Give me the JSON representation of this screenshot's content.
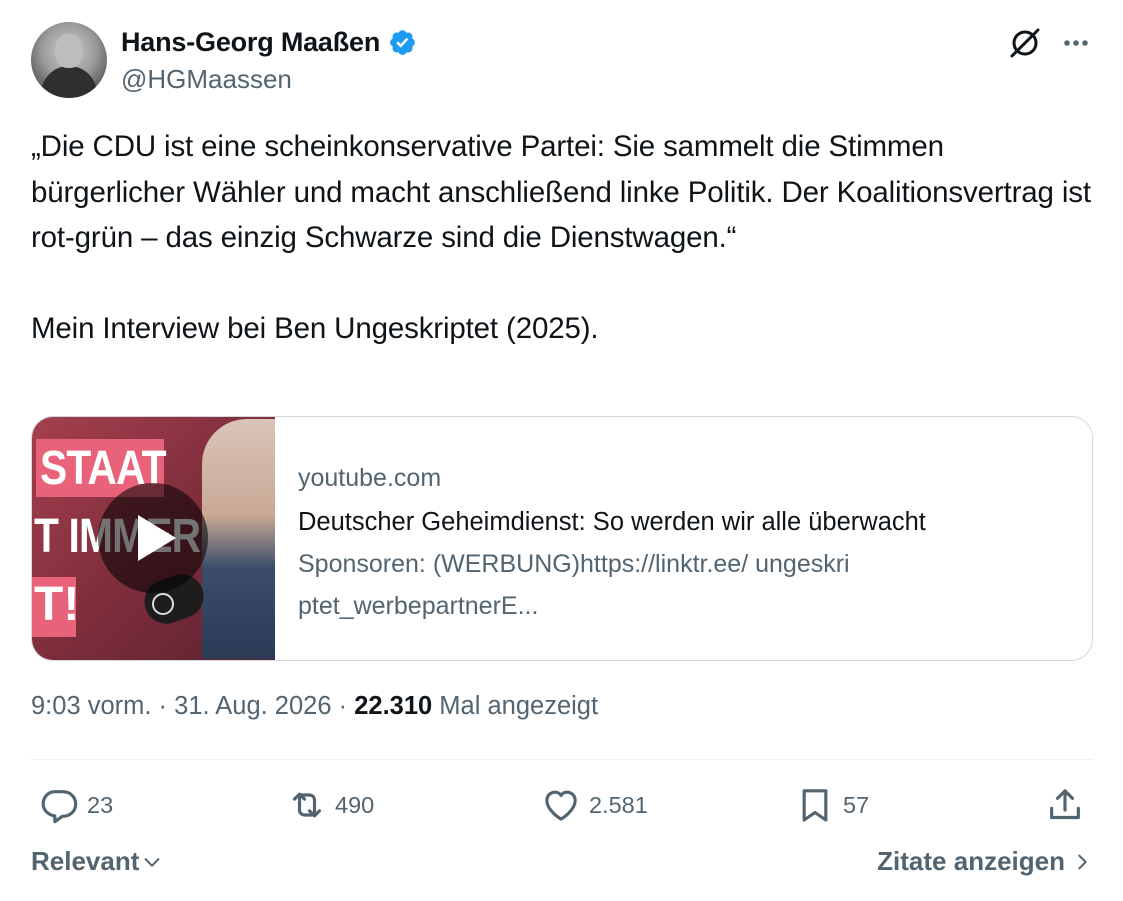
{
  "author": {
    "display_name": "Hans-Georg Maaßen",
    "handle": "@HGMaassen",
    "verified": true,
    "verified_color": "#1d9bf0"
  },
  "header_icons": [
    "grok-icon",
    "more-icon"
  ],
  "tweet": {
    "text": "„Die CDU ist eine scheinkonservative Partei: Sie sammelt die Stimmen bürgerlicher Wähler und macht anschließend linke Politik. Der Koalitionsvertrag ist rot-grün – das einzig Schwarze sind die Dienstwagen.“\n\nMein Interview bei Ben Ungeskriptet (2025)."
  },
  "link_card": {
    "thumbnail_text": [
      "STAAT",
      "T IMMER",
      "T!"
    ],
    "domain": "youtube.com",
    "title": "Deutscher Geheimdienst: So werden wir alle überwacht",
    "description": "Sponsoren: (WERBUNG)https://linktr.ee/ ungeskriptet_werbepartnerE..."
  },
  "meta": {
    "time": "9:03 vorm.",
    "separator": " · ",
    "date": "31. Aug. 2026",
    "views_count": "22.310",
    "views_label": " Mal angezeigt"
  },
  "actions": {
    "replies": "23",
    "reposts": "490",
    "likes": "2.581",
    "bookmarks": "57"
  },
  "footer": {
    "sort_label": "Relevant",
    "quotes_label": "Zitate anzeigen"
  },
  "colors": {
    "text_primary": "#0f1419",
    "text_secondary": "#536471",
    "border": "#cfd9de"
  }
}
